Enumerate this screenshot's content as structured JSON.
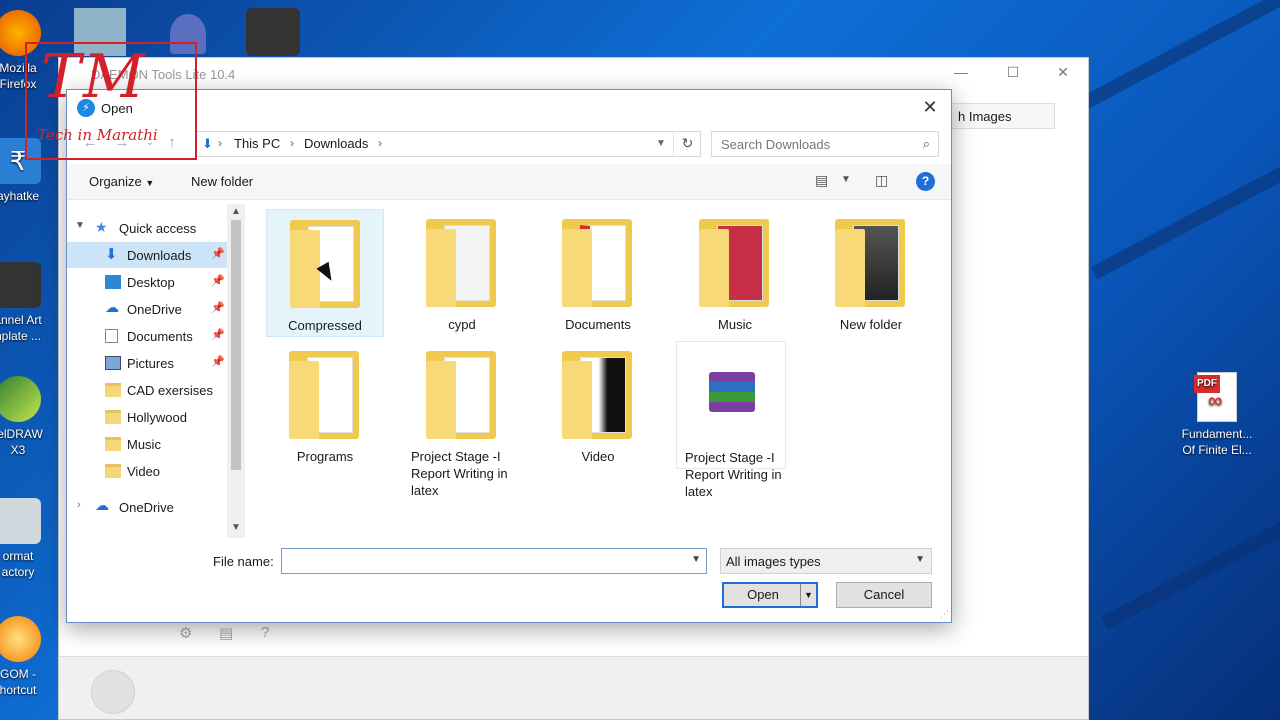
{
  "desktop": {
    "icons_left": [
      {
        "label": "Mozilla\nFirefox",
        "icon": "firefox-icon"
      },
      {
        "label": "ayhatke",
        "icon": "rupee-icon"
      },
      {
        "label": "annel Art\nnplate ...",
        "icon": "image-icon"
      },
      {
        "label": "relDRAW\nX3",
        "icon": "coreldraw-icon"
      },
      {
        "label": "ormat\nactory",
        "icon": "format-factory-icon"
      },
      {
        "label": "GOM -\nhortcut",
        "icon": "gom-player-icon"
      }
    ],
    "icon_right": {
      "label": "Fundament...\nOf Finite El...",
      "icon": "pdf-file-icon",
      "badge": "PDF"
    }
  },
  "background_app": {
    "title": "DAEMON Tools Lite 10.4",
    "images_button": "h Images"
  },
  "watermark": {
    "logo": "TM",
    "tagline": "Tech in Marathi"
  },
  "dialog": {
    "title": "Open",
    "breadcrumb": [
      "This PC",
      "Downloads"
    ],
    "search_placeholder": "Search Downloads",
    "toolbar": {
      "organize": "Organize",
      "new_folder": "New folder"
    },
    "nav": [
      {
        "label": "Quick access",
        "type": "header"
      },
      {
        "label": "Downloads",
        "pinned": true,
        "selected": true
      },
      {
        "label": "Desktop",
        "pinned": true
      },
      {
        "label": "OneDrive",
        "pinned": true
      },
      {
        "label": "Documents",
        "pinned": true
      },
      {
        "label": "Pictures",
        "pinned": true
      },
      {
        "label": "CAD exersises"
      },
      {
        "label": "Hollywood"
      },
      {
        "label": "Music"
      },
      {
        "label": "Video"
      },
      {
        "label": "OneDrive",
        "type": "header"
      }
    ],
    "items": [
      {
        "label": "Compressed"
      },
      {
        "label": "cypd"
      },
      {
        "label": "Documents"
      },
      {
        "label": "Music"
      },
      {
        "label": "New folder"
      },
      {
        "label": "Programs"
      },
      {
        "label": "Project Stage -I Report Writing in latex"
      },
      {
        "label": "Video"
      },
      {
        "label": "Project Stage -I Report Writing in latex"
      }
    ],
    "file_name_label": "File name:",
    "file_name_value": "",
    "file_type": "All images types",
    "open_button": "Open",
    "cancel_button": "Cancel"
  },
  "colors": {
    "accent": "#1e6fd6",
    "selection": "#cce4f7",
    "folder": "#f0c94f",
    "watermark": "#d2212a"
  }
}
